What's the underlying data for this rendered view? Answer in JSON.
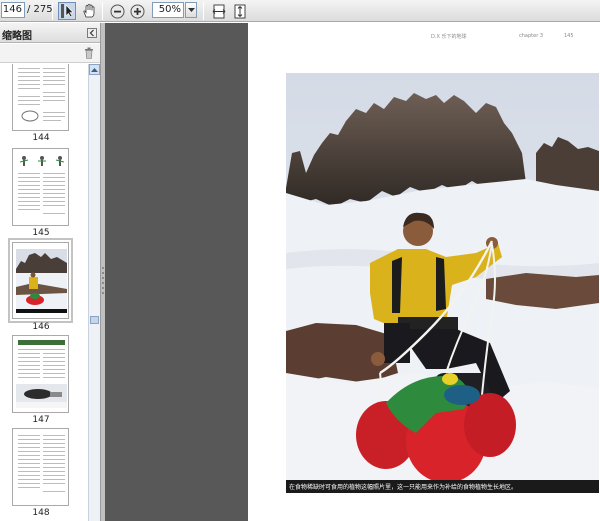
{
  "toolbar": {
    "page_current": "146",
    "page_total": "/ 275",
    "zoom_value": "50%",
    "icons": [
      "select-tool-icon",
      "hand-tool-icon",
      "zoom-out-icon",
      "zoom-in-icon",
      "fit-width-icon",
      "fit-page-icon"
    ]
  },
  "sidebar": {
    "title": "缩略图",
    "thumbnails": [
      {
        "label": "144",
        "kind": "text"
      },
      {
        "label": "145",
        "kind": "diagram"
      },
      {
        "label": "146",
        "kind": "photo",
        "selected": true
      },
      {
        "label": "147",
        "kind": "text-with-image"
      },
      {
        "label": "148",
        "kind": "text"
      }
    ]
  },
  "document": {
    "header_left": "D.X 乐下的地球",
    "header_chapter": "chapter 3",
    "header_page": "145",
    "caption": "在食物稀缺时可食用的植物这幅照片里，这一只能用来作为补给的食物植物生长地区。"
  },
  "colors": {
    "toolbar_bg": "#dcdcdc",
    "doc_bg": "#585858",
    "jacket_yellow": "#d9b21c",
    "bag_red": "#d8232a",
    "bag_green": "#2e8b3e"
  }
}
